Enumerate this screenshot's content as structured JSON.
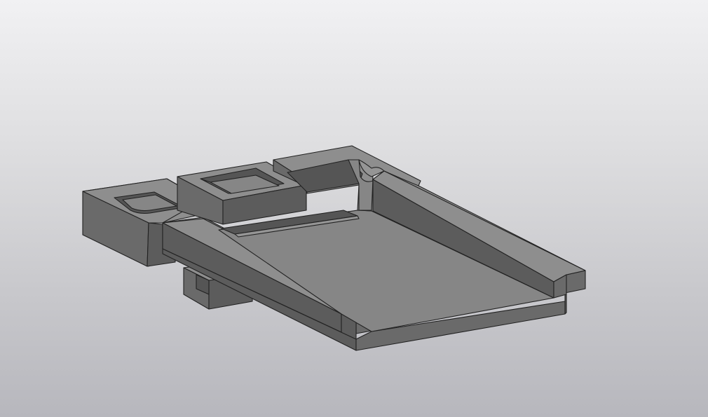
{
  "scene": {
    "background_top": "#f1f1f3",
    "background_bottom": "#b7b7bd",
    "part_color": "#8e8e8e",
    "edge_color": "#222222",
    "view": "isometric-shaded-with-edges"
  }
}
